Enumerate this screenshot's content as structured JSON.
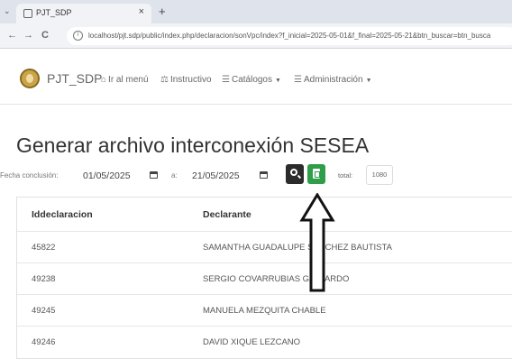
{
  "browser": {
    "tab_title": "PJT_SDP",
    "tab_close": "×",
    "new_tab": "+",
    "tab_menu": "⌄",
    "back": "←",
    "forward": "→",
    "reload": "C",
    "url": "localhost/pjt.sdp/public/index.php/declaracion/sonVpc/index?f_inicial=2025-05-01&f_final=2025-05-21&btn_buscar=btn_busca"
  },
  "navbar": {
    "brand": "PJT_SDP",
    "items": [
      {
        "label": "Ir al menú",
        "icon": "home-icon",
        "dropdown": false
      },
      {
        "label": "Instructivo",
        "icon": "scale-icon",
        "dropdown": false
      },
      {
        "label": "Catálogos",
        "icon": "database-icon",
        "dropdown": true
      },
      {
        "label": "Administración",
        "icon": "database-icon",
        "dropdown": true
      }
    ]
  },
  "page": {
    "title": "Generar archivo interconexión SESEA"
  },
  "filters": {
    "fecha_label": "Fecha conclusión:",
    "fecha_inicial": "01/05/2025",
    "separator": "a:",
    "fecha_final": "21/05/2025",
    "total_label": "total:",
    "total_value": "1080"
  },
  "table": {
    "columns": [
      "Iddeclaracion",
      "Declarante"
    ],
    "rows": [
      [
        "45822",
        "SAMANTHA GUADALUPE SANCHEZ BAUTISTA"
      ],
      [
        "49238",
        "SERGIO COVARRUBIAS GALLARDO"
      ],
      [
        "49245",
        "MANUELA MEZQUITA CHABLE"
      ],
      [
        "49246",
        "DAVID XIQUE LEZCANO"
      ]
    ]
  },
  "colors": {
    "search_button": "#2b2b2b",
    "excel_button": "#2e9e4a",
    "browser_chrome": "#dfe3eb"
  }
}
